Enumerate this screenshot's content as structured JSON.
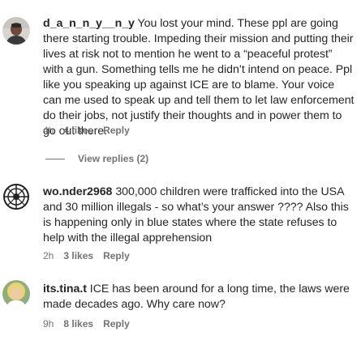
{
  "comments": [
    {
      "username": "d_a_n_n_y__n_y",
      "text": "You lost your mind. These ppl are going there starting trouble. Impeding their mission and putting their lives at risk not to mention he went to a “peaceful protest” with a gun. Something tells me he didn’t intend on peace. Ppl like you speaking up against ICE are to blame. Your voice can me used to speak up and tell them to let law enforcement do their jobs, not justify their thoughts and in power them to go out there.",
      "time": "4h",
      "likes": "4 likes",
      "reply": "Reply",
      "view_replies": "View replies (2)"
    },
    {
      "username": "wo.nder2968",
      "text": "300,000 children were trafficked into the USA and 30 million illegals - so what’s your answer ???? Also this is happening only in blue states where the state refuses to help with the illegal apprehension",
      "time": "2h",
      "likes": "3 likes",
      "reply": "Reply"
    },
    {
      "username": "its.tina.t",
      "text": "ICE has been around for a long time, the laws were made decades ago. Why care now?",
      "time": "9h",
      "likes": "8 likes",
      "reply": "Reply"
    }
  ],
  "colors": {
    "text": "#262626",
    "secondary": "#737373",
    "background": "#ffffff"
  }
}
